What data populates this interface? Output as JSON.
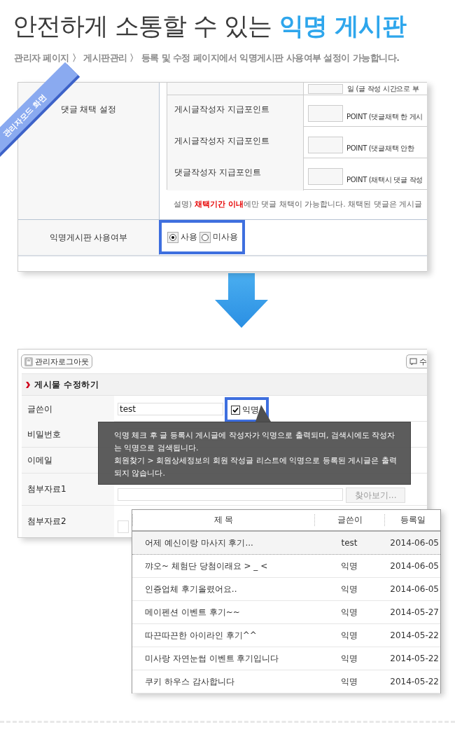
{
  "headline": {
    "text": "안전하게 소통할 수 있는",
    "highlight": "익명 게시판"
  },
  "subtitle": "관리자 페이지 〉 게시판관리 〉 등록 및 수정 페이지에서 익명게시판 사용여부 설정이 가능합니다.",
  "admin_screen": {
    "ribbon": "관리자모드 화면",
    "section_label": "댓글 채택 설정",
    "top_row_text": "일 (글 작성 시간으로 부",
    "point_rows": [
      {
        "label": "게시글작성자 지급포인트",
        "note": "POINT (댓글채택 한 게시"
      },
      {
        "label": "게시글작성자 지급포인트",
        "note": "POINT (댓글채택 안한"
      },
      {
        "label": "댓글작성자 지급포인트",
        "note": "POINT (채택시 댓글 작성"
      }
    ],
    "explanation": "설명) **채택기간 이내**에만 댓글 채택이 가능합니다. 채택된 댓글은 게시글",
    "anonymous_setting": {
      "label": "익명게시판 사용여부",
      "options": [
        {
          "label": "사용",
          "selected": true
        },
        {
          "label": "미사용",
          "selected": false
        }
      ]
    }
  },
  "edit_screen": {
    "logout_button": "관리자로그아웃",
    "right_button": "수",
    "section_title": "게시물 수정하기",
    "fields": [
      {
        "kind": "author",
        "label": "글쓴이",
        "value": "test",
        "anonymous": {
          "label": "익명",
          "checked": true
        }
      },
      {
        "kind": "password",
        "label": "비밀번호"
      },
      {
        "kind": "text",
        "label": "이메일"
      },
      {
        "kind": "file",
        "label": "첨부자료1",
        "button": "찾아보기..."
      },
      {
        "kind": "file",
        "label": "첨부자료2"
      }
    ],
    "tooltip": [
      "익명 체크 후 글 등록시 게시글에 작성자가 익명으로 출력되며, 검색시에도 작성자는 익명으로 검색됩니다.",
      "회원찾기 > 회원상세정보의 회원 작성글 리스트에 익명으로 등록된 게시글은 출력되지 않습니다."
    ]
  },
  "board_list": {
    "columns": [
      "제 목",
      "글쓴이",
      "등록일"
    ],
    "rows": [
      {
        "title": "어제 예신이랑 마사지 후기...",
        "author": "test",
        "date": "2014-06-05",
        "selected": true
      },
      {
        "title": "꺄오~ 체험단 당첨이래요 > _ <",
        "author": "익명",
        "date": "2014-06-05",
        "selected": false
      },
      {
        "title": "인증업체 후기올렸어요..",
        "author": "익명",
        "date": "2014-06-05",
        "selected": false
      },
      {
        "title": "메이펜션 이벤트 후기~~",
        "author": "익명",
        "date": "2014-05-27",
        "selected": false
      },
      {
        "title": "따끈따끈한 아이라인 후기^^",
        "author": "익명",
        "date": "2014-05-22",
        "selected": false
      },
      {
        "title": "미사랑 자연눈썹 이벤트 후기입니다",
        "author": "익명",
        "date": "2014-05-22",
        "selected": false
      },
      {
        "title": "쿠키 하우스 감사합니다",
        "author": "익명",
        "date": "2014-05-22",
        "selected": false
      }
    ]
  }
}
